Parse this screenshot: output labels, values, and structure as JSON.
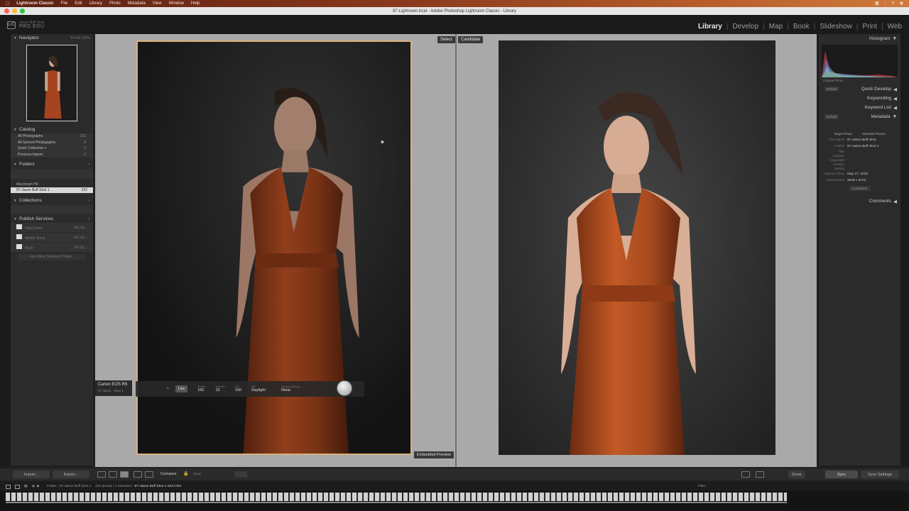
{
  "menubar": {
    "items": [
      "Lightroom Classic",
      "File",
      "Edit",
      "Library",
      "Photo",
      "Metadata",
      "View",
      "Window",
      "Help"
    ]
  },
  "window": {
    "title": "97-Lightroom.lrcat - Adobe Photoshop Lightroom Classic - Library"
  },
  "identity": {
    "logo": "LrC",
    "line1": "Jason Buff Shot",
    "line2": "PRO EDU"
  },
  "modules": [
    "Library",
    "Develop",
    "Map",
    "Book",
    "Slideshow",
    "Print",
    "Web"
  ],
  "left_panel": {
    "navigator": {
      "label": "Navigator",
      "zoom": [
        "Fit",
        "Fill",
        "100%"
      ]
    },
    "catalog": {
      "label": "Catalog",
      "items": [
        {
          "name": "All Photographs",
          "count": "222"
        },
        {
          "name": "All Synced Photographs",
          "count": "0"
        },
        {
          "name": "Quick Collection +",
          "count": "0"
        },
        {
          "name": "Previous Import",
          "count": "0"
        }
      ]
    },
    "folders": {
      "label": "Folders",
      "volume": {
        "name": "Macintosh HD",
        "size": ""
      },
      "selected": {
        "name": "97-Jason Buff Shot 1",
        "count": "222"
      }
    },
    "collections": {
      "label": "Collections"
    },
    "publish": {
      "label": "Publish Services",
      "items": [
        {
          "name": "Hard Drive",
          "action": "Set Up..."
        },
        {
          "name": "Adobe Stock",
          "action": "Set Up..."
        },
        {
          "name": "Flickr",
          "action": "Set Up..."
        }
      ],
      "find_more": "Find More Services Online..."
    }
  },
  "main": {
    "select_label": "Select",
    "candidate_label": "Candidate",
    "embedded_preview": "Embedded Preview",
    "camera": {
      "name": "Canon EOS R6",
      "file": "97-Jason - Shot 1"
    },
    "hud": {
      "live": "Live",
      "fields": [
        {
          "label": "Shutter",
          "value": "160"
        },
        {
          "label": "Aperture",
          "value": "10"
        },
        {
          "label": "ISO",
          "value": "160"
        },
        {
          "label": "WB",
          "value": "Daylight"
        },
        {
          "label": "Develop Settings",
          "value": "None"
        }
      ]
    }
  },
  "right_panel": {
    "histogram": "Histogram",
    "original_photo": "Original Photo",
    "quick_develop": "Quick Develop",
    "keywording": "Keywording",
    "keyword_list": "Keyword List",
    "metadata": "Metadata",
    "preset_label": "Default",
    "metadata_preset": "Default",
    "tabs": [
      "Target Photo",
      "Selected Photos"
    ],
    "fields": [
      {
        "k": "File Name",
        "v": "97-Jason Buff Shot"
      },
      {
        "k": "Folder",
        "v": "97-Jason Buff Shot 1"
      },
      {
        "k": "Title",
        "v": ""
      },
      {
        "k": "Caption",
        "v": ""
      },
      {
        "k": "Copyright",
        "v": ""
      },
      {
        "k": "Creator",
        "v": ""
      },
      {
        "k": "Rating",
        "v": ""
      },
      {
        "k": "Capture Time",
        "v": "May 27, 2023"
      },
      {
        "k": "Dimensions",
        "v": "3648 x 5472"
      }
    ],
    "customize": "Customize",
    "comments": "Comments"
  },
  "toolbar": {
    "import": "Import...",
    "export": "Export...",
    "compare": "Compare",
    "zoom_label": "Zoom",
    "done": "Done",
    "sync": "Sync",
    "sync_settings": "Sync Settings"
  },
  "filmstrip": {
    "folder_label": "Folder : 97-Jason Buff Shot 1",
    "count": "222 photos / 1 selected /",
    "current": "97-Jason Buff Shot 1-222.CR3",
    "filter_label": "Filter :"
  },
  "colors": {
    "accent_select": "#d8b079",
    "dress": "#b4522a"
  }
}
